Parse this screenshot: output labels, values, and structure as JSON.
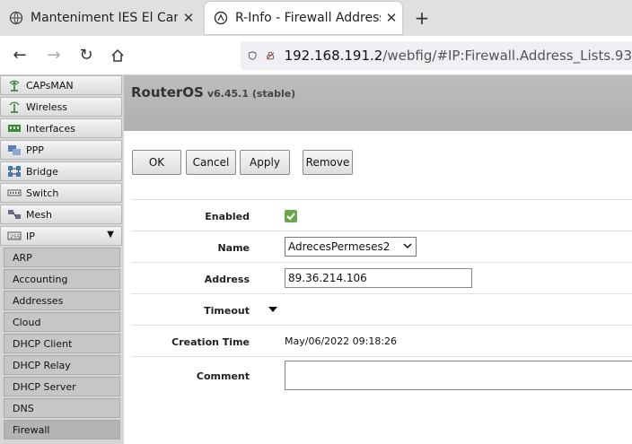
{
  "browser": {
    "tabs": [
      {
        "title": "Manteniment IES El Camí"
      },
      {
        "title": "R-Info - Firewall Address List"
      }
    ],
    "url_host": "192.168.191.2",
    "url_path": "/webfig/#IP:Firewall.Address_Lists.93"
  },
  "sidebar": {
    "items": [
      {
        "label": "CAPsMAN",
        "icon": "capsman-icon"
      },
      {
        "label": "Wireless",
        "icon": "wireless-icon"
      },
      {
        "label": "Interfaces",
        "icon": "interfaces-icon"
      },
      {
        "label": "PPP",
        "icon": "ppp-icon"
      },
      {
        "label": "Bridge",
        "icon": "bridge-icon"
      },
      {
        "label": "Switch",
        "icon": "switch-icon"
      },
      {
        "label": "Mesh",
        "icon": "mesh-icon"
      },
      {
        "label": "IP",
        "icon": "ip-icon",
        "expanded": true
      }
    ],
    "subitems": [
      "ARP",
      "Accounting",
      "Addresses",
      "Cloud",
      "DHCP Client",
      "DHCP Relay",
      "DHCP Server",
      "DNS",
      "Firewall"
    ],
    "active_subitem": "Firewall"
  },
  "header": {
    "product": "RouterOS",
    "version": "v6.45.1 (stable)"
  },
  "buttons": {
    "ok": "OK",
    "cancel": "Cancel",
    "apply": "Apply",
    "remove": "Remove"
  },
  "form": {
    "enabled_label": "Enabled",
    "enabled_value": true,
    "name_label": "Name",
    "name_value": "AdrecesPermeses2",
    "address_label": "Address",
    "address_value": "89.36.214.106",
    "timeout_label": "Timeout",
    "creation_time_label": "Creation Time",
    "creation_time_value": "May/06/2022 09:18:26",
    "comment_label": "Comment",
    "comment_value": ""
  },
  "colors": {
    "check_green": "#6aa84f",
    "header_gray": "#b8b8b8"
  }
}
